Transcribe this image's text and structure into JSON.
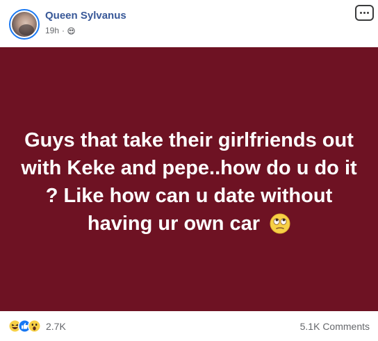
{
  "post": {
    "author": "Queen Sylvanus",
    "time": "19h",
    "separator": "·",
    "privacy_icon": "friends-globe-icon",
    "text": "Guys that take their girlfriends out with Keke and pepe..how do u do it ? Like how can u date without having ur own car",
    "emoji": "face-with-rolling-eyes",
    "background_color": "#6e1223"
  },
  "footer": {
    "reactions": [
      "haha",
      "like",
      "wow"
    ],
    "reaction_count": "2.7K",
    "comments": "5.1K Comments"
  },
  "colors": {
    "name": "#385898",
    "meta": "#65676b",
    "like_blue": "#1877f2",
    "emoji_yellow": "#f7d046"
  }
}
